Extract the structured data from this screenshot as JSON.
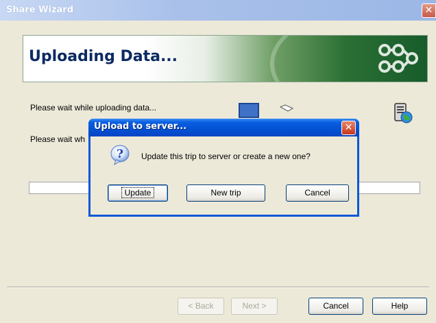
{
  "wizard": {
    "title": "Share Wizard",
    "close_glyph": "✕",
    "banner_title": "Uploading Data...",
    "status_1": "Please wait while uploading data...",
    "status_2": "Please wait wh",
    "progress": 0,
    "buttons": {
      "back": "< Back",
      "next": "Next >",
      "cancel": "Cancel",
      "help": "Help"
    }
  },
  "dialog": {
    "title": "Upload to server...",
    "close_glyph": "✕",
    "message": "Update this trip to server or create a new one?",
    "buttons": {
      "update": "Update",
      "new_trip": "New trip",
      "cancel": "Cancel"
    }
  },
  "icons": {
    "question": "question-icon",
    "server": "server-globe-icon",
    "logo": "share-logo-icon"
  }
}
